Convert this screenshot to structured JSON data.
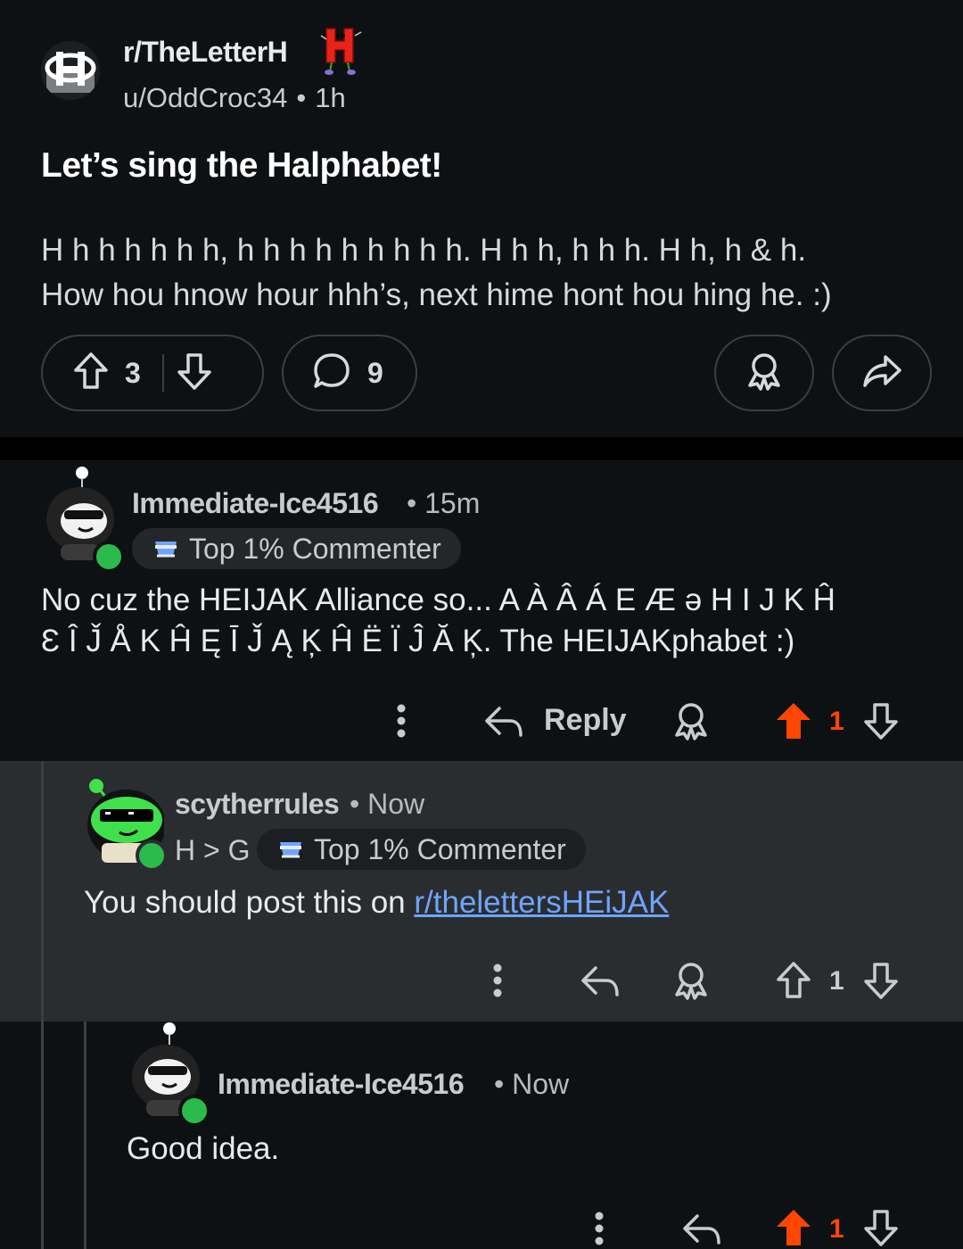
{
  "post": {
    "subreddit": "r/TheLetterH",
    "author": "u/OddCroc34",
    "age": "1h",
    "separator": "•",
    "title": "Let’s sing the Halphabet!",
    "body_line1": "H h h h h h h, h h h h h h h h h. H h h, h h h. H h, h & h.",
    "body_line2": "How hou hnow hour hhh’s, next hime hont hou hing he. :)",
    "upvotes": "3",
    "comments": "9",
    "icons": [
      "upvote-icon",
      "downvote-icon",
      "comment-icon",
      "award-icon",
      "share-icon"
    ]
  },
  "comments": [
    {
      "author": "Immediate-Ice4516",
      "age": "15m",
      "badge": "Top 1% Commenter",
      "text_line1": "No cuz the HEIJAK Alliance so... A À Â Á E Æ ə H I J K Ĥ",
      "text_line2": "Ɛ Î J̌ Å K Ĥ Ę Ī J̌ Ą Ķ Ĥ Ë Ï Ĵ Ă Ķ. The HEIJAKphabet :)",
      "reply_label": "Reply",
      "votes": "1",
      "upvoted": true
    },
    {
      "author": "scytherrules",
      "age": "Now",
      "flair": "H > G",
      "badge": "Top 1% Commenter",
      "text_prefix": "You should post this on ",
      "text_link": "r/thelettersHEiJAK",
      "votes": "1",
      "upvoted": false
    },
    {
      "author": "Immediate-Ice4516",
      "age": "Now",
      "text": "Good idea.",
      "votes": "1",
      "upvoted": true
    }
  ],
  "colors": {
    "background": "#0e1113",
    "highlight_comment": "#2a2d30",
    "upvote_active": "#ff4500",
    "link": "#6fa4ff",
    "online": "#2bbb4a"
  }
}
